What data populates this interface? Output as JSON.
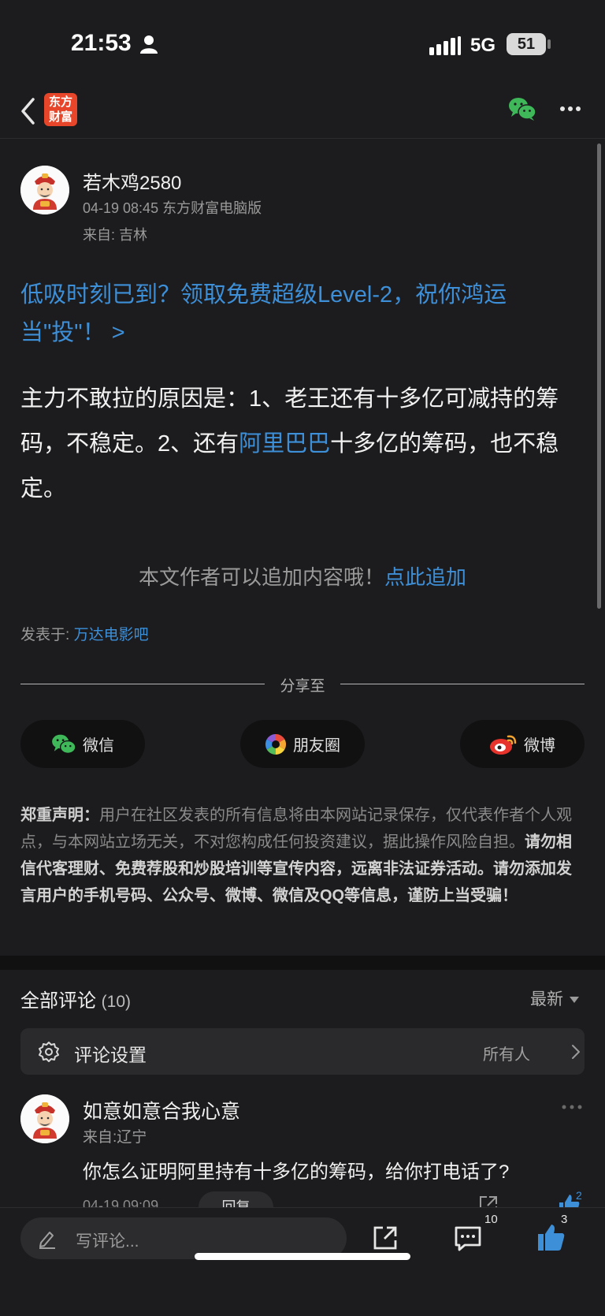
{
  "status_bar": {
    "time": "21:53",
    "network": "5G",
    "battery": "51"
  },
  "nav": {
    "logo_line1": "东方",
    "logo_line2": "财富"
  },
  "post": {
    "author": "若木鸡2580",
    "meta": "04-19 08:45 东方财富电脑版",
    "location": "来自: 吉林",
    "promo_link": "低吸时刻已到？领取免费超级Level-2，祝你鸿运当\"投\"！ >",
    "body_before": "主力不敢拉的原因是：1、老王还有十多亿可减持的筹码，不稳定。2、还有",
    "body_link": "阿里巴巴",
    "body_after": "十多亿的筹码，也不稳定。",
    "append_text": "本文作者可以追加内容哦！",
    "append_link": "点此追加",
    "published_label": "发表于: ",
    "published_bar": "万达电影吧"
  },
  "share": {
    "title": "分享至",
    "wechat": "微信",
    "moments": "朋友圈",
    "weibo": "微博"
  },
  "disclaimer": {
    "label": "郑重声明：",
    "text": "用户在社区发表的所有信息将由本网站记录保存，仅代表作者个人观点，与本网站立场无关，不对您构成任何投资建议，据此操作风险自担。",
    "bold_text": "请勿相信代客理财、免费荐股和炒股培训等宣传内容，远离非法证券活动。请勿添加发言用户的手机号码、公众号、微博、微信及QQ等信息，谨防上当受骗！"
  },
  "comments": {
    "title": "全部评论",
    "count": "(10)",
    "sort": "最新",
    "settings_label": "评论设置",
    "settings_value": "所有人",
    "items": [
      {
        "name": "如意如意合我心意",
        "location": "来自:辽宁",
        "text": "你怎么证明阿里持有十多亿的筹码，给你打电话了?",
        "date": "04-19 09:09",
        "reply_label": "回复",
        "likes": "2"
      }
    ]
  },
  "bottom_bar": {
    "placeholder": "写评论...",
    "comment_count": "10",
    "like_count": "3"
  },
  "colors": {
    "link": "#3d8fd8",
    "background": "#1c1c1e",
    "logo": "#e8462a",
    "wechat_green": "#3fb85a"
  }
}
